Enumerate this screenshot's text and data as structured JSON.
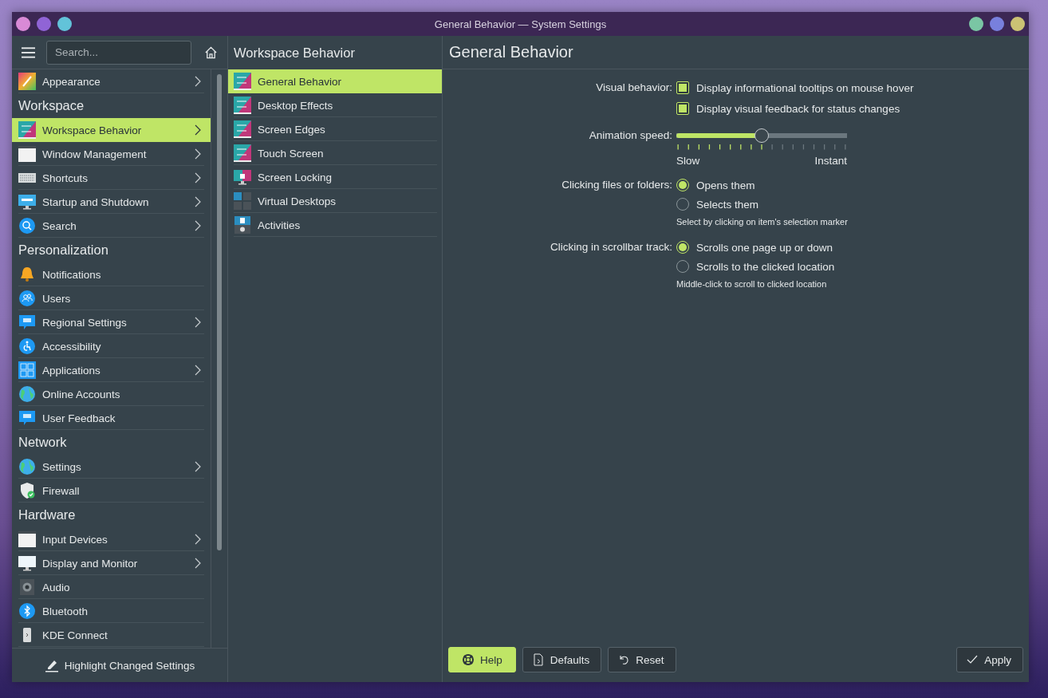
{
  "window": {
    "title": "General Behavior — System Settings",
    "buttons_left": [
      {
        "color": "#d98ad6"
      },
      {
        "color": "#9064d6"
      },
      {
        "color": "#62c3d9"
      }
    ],
    "buttons_right": [
      {
        "color": "#7ac6a4"
      },
      {
        "color": "#7880dd"
      },
      {
        "color": "#cbc274"
      }
    ]
  },
  "sidebar": {
    "search": {
      "placeholder": "Search..."
    },
    "sections": [
      {
        "items": [
          {
            "label": "Appearance",
            "selected": false,
            "has_submenu": true
          }
        ]
      },
      {
        "heading": "Workspace",
        "items": [
          {
            "label": "Workspace Behavior",
            "selected": true,
            "has_submenu": true
          },
          {
            "label": "Window Management",
            "selected": false,
            "has_submenu": true
          },
          {
            "label": "Shortcuts",
            "selected": false,
            "has_submenu": true
          },
          {
            "label": "Startup and Shutdown",
            "selected": false,
            "has_submenu": true
          },
          {
            "label": "Search",
            "selected": false,
            "has_submenu": true
          }
        ]
      },
      {
        "heading": "Personalization",
        "items": [
          {
            "label": "Notifications",
            "selected": false,
            "has_submenu": false
          },
          {
            "label": "Users",
            "selected": false,
            "has_submenu": false
          },
          {
            "label": "Regional Settings",
            "selected": false,
            "has_submenu": true
          },
          {
            "label": "Accessibility",
            "selected": false,
            "has_submenu": false
          },
          {
            "label": "Applications",
            "selected": false,
            "has_submenu": true
          },
          {
            "label": "Online Accounts",
            "selected": false,
            "has_submenu": false
          },
          {
            "label": "User Feedback",
            "selected": false,
            "has_submenu": false
          }
        ]
      },
      {
        "heading": "Network",
        "items": [
          {
            "label": "Settings",
            "selected": false,
            "has_submenu": true
          },
          {
            "label": "Firewall",
            "selected": false,
            "has_submenu": false
          }
        ]
      },
      {
        "heading": "Hardware",
        "items": [
          {
            "label": "Input Devices",
            "selected": false,
            "has_submenu": true
          },
          {
            "label": "Display and Monitor",
            "selected": false,
            "has_submenu": true
          },
          {
            "label": "Audio",
            "selected": false,
            "has_submenu": false
          },
          {
            "label": "Bluetooth",
            "selected": false,
            "has_submenu": false
          },
          {
            "label": "KDE Connect",
            "selected": false,
            "has_submenu": false
          }
        ]
      }
    ],
    "footer_button": "Highlight Changed Settings"
  },
  "subpanel": {
    "title": "Workspace Behavior",
    "items": [
      {
        "label": "General Behavior",
        "selected": true
      },
      {
        "label": "Desktop Effects",
        "selected": false
      },
      {
        "label": "Screen Edges",
        "selected": false
      },
      {
        "label": "Touch Screen",
        "selected": false
      },
      {
        "label": "Screen Locking",
        "selected": false
      },
      {
        "label": "Virtual Desktops",
        "selected": false
      },
      {
        "label": "Activities",
        "selected": false
      }
    ]
  },
  "page": {
    "title": "General Behavior",
    "visual_behavior": {
      "label": "Visual behavior:",
      "options": [
        {
          "label": "Display informational tooltips on mouse hover",
          "checked": true
        },
        {
          "label": "Display visual feedback for status changes",
          "checked": true
        }
      ]
    },
    "animation_speed": {
      "label": "Animation speed:",
      "level": 0.5,
      "min_label": "Slow",
      "max_label": "Instant"
    },
    "radio_groups": [
      {
        "label": "Clicking files or folders:",
        "options": [
          {
            "label": "Opens them",
            "selected": true
          },
          {
            "label": "Selects them",
            "selected": false
          }
        ],
        "hint": "Select by clicking on item's selection marker"
      },
      {
        "label": "Clicking in scrollbar track:",
        "options": [
          {
            "label": "Scrolls one page up or down",
            "selected": true
          },
          {
            "label": "Scrolls to the clicked location",
            "selected": false
          }
        ],
        "hint": "Middle-click to scroll to clicked location"
      }
    ]
  },
  "left_buttons": [
    {
      "label": "Help",
      "highlighted": true
    },
    {
      "label": "Defaults",
      "highlighted": false
    },
    {
      "label": "Reset",
      "highlighted": false
    }
  ],
  "right_buttons": [
    {
      "label": "Apply",
      "highlighted": false
    }
  ]
}
